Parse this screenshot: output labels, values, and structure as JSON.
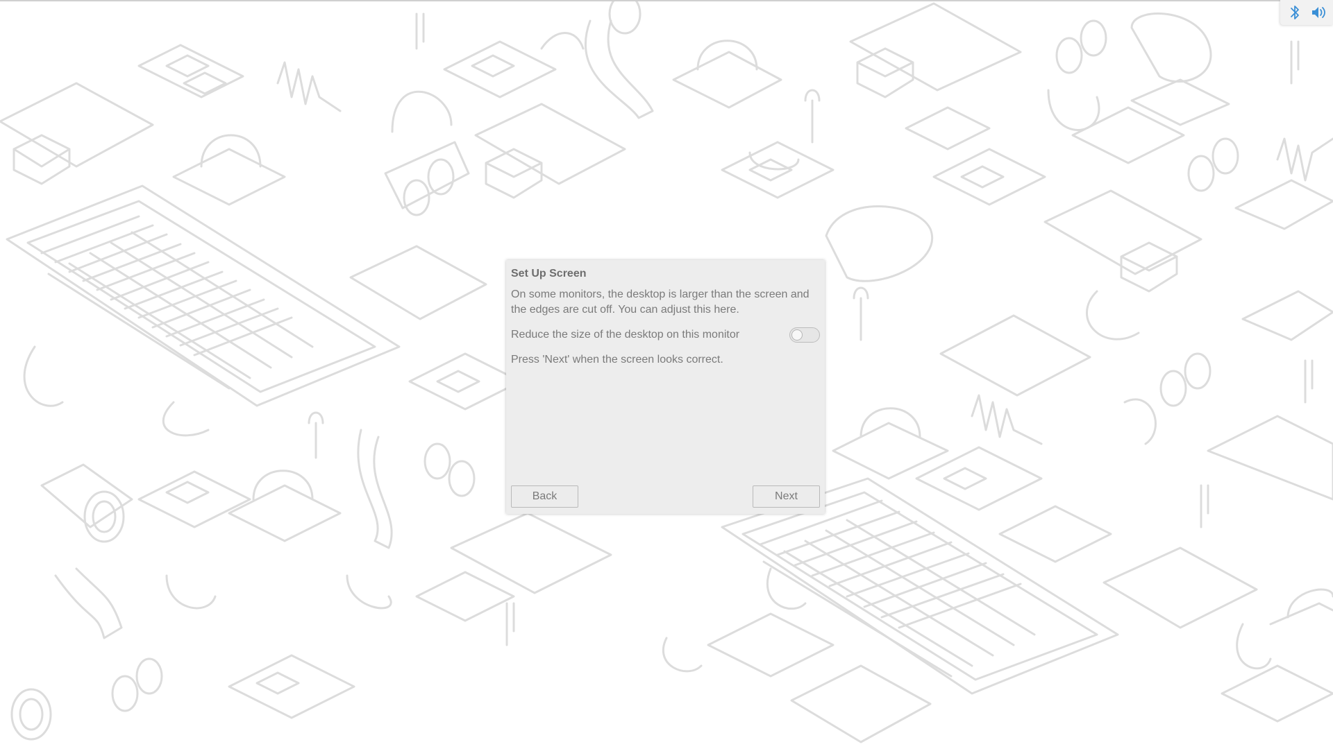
{
  "tray": {
    "icons": [
      "bluetooth-icon",
      "volume-icon"
    ],
    "accent": "#3a8fd6"
  },
  "dialog": {
    "title": "Set Up Screen",
    "description": "On some monitors, the desktop is larger than the screen and the edges are cut off. You can adjust this here.",
    "option_label": "Reduce the size of the desktop on this monitor",
    "option_enabled": false,
    "hint": "Press 'Next' when the screen looks correct.",
    "back_label": "Back",
    "next_label": "Next"
  },
  "colors": {
    "background": "#ffffff",
    "wallpaper_lines": "#dcdcdc",
    "dialog_bg": "#ededed"
  }
}
